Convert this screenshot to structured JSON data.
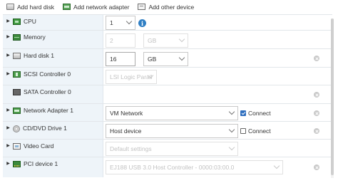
{
  "toolbar": {
    "add_hard_disk": "Add hard disk",
    "add_network_adapter": "Add network adapter",
    "add_other_device": "Add other device"
  },
  "rows": {
    "cpu": {
      "label": "CPU",
      "value": "1"
    },
    "memory": {
      "label": "Memory",
      "value": "2",
      "unit": "GB"
    },
    "hard_disk": {
      "label": "Hard disk 1",
      "value": "16",
      "unit": "GB"
    },
    "scsi": {
      "label": "SCSI Controller 0",
      "value": "LSI Logic Paralle"
    },
    "sata": {
      "label": "SATA Controller 0"
    },
    "network": {
      "label": "Network Adapter 1",
      "value": "VM Network",
      "connect_label": "Connect",
      "connected": true
    },
    "cddvd": {
      "label": "CD/DVD Drive 1",
      "value": "Host device",
      "connect_label": "Connect",
      "connected": false
    },
    "video": {
      "label": "Video Card",
      "value": "Default settings"
    },
    "pci": {
      "label": "PCI device 1",
      "value": "EJ188 USB 3.0 Host Controller - 0000:03:00.0"
    }
  },
  "icons": {
    "toolbar": [
      "hard-disk-icon",
      "network-adapter-icon",
      "other-device-icon"
    ],
    "info": "info-icon",
    "remove": "remove-icon"
  },
  "colors": {
    "label_column_bg": "#eef4f9",
    "info_icon": "#2f7fc4",
    "checkbox_checked": "#2f6fbf"
  }
}
